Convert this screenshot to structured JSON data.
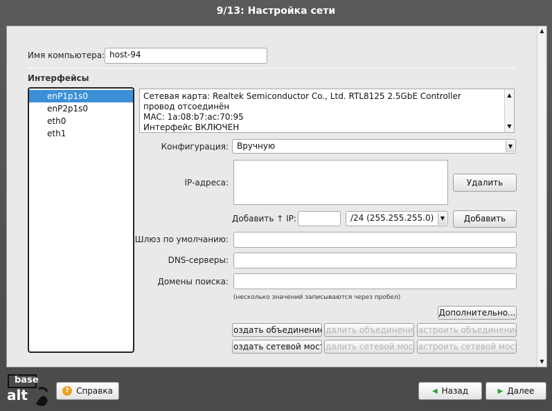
{
  "window": {
    "title": "9/13: Настройка сети"
  },
  "form": {
    "hostname_label": "Имя компьютера:",
    "hostname_value": "host-94",
    "interfaces_title": "Интерфейсы",
    "interfaces": [
      "enP1p1s0",
      "enP2p1s0",
      "eth0",
      "eth1"
    ],
    "selected_interface": "enP1p1s0",
    "info_lines": [
      "Сетевая карта: Realtek Semiconductor Co., Ltd. RTL8125 2.5GbE Controller",
      "провод отсоединён",
      "MAC: 1a:08:b7:ac:70:95",
      "Интерфейс ВКЛЮЧЕН"
    ],
    "config_label": "Конфигурация:",
    "config_value": "Вручную",
    "ip_label": "IP-адреса:",
    "delete_button": "Удалить",
    "add_ip_label": "Добавить ↑ IP:",
    "mask_value": "/24 (255.255.255.0)",
    "add_button": "Добавить",
    "gateway_label": "Шлюз по умолчанию:",
    "dns_label": "DNS-серверы:",
    "domains_label": "Домены поиска:",
    "hint": "(несколько значений записываются через пробел)",
    "advanced_button": "Дополнительно...",
    "bond_create": "оздать объединение.",
    "bond_delete": "далить объединение",
    "bond_config": "астроить объединение",
    "bridge_create": "оздать сетевой мост.",
    "bridge_delete": "далить сетевой мост",
    "bridge_config": "астроить сетевой мост"
  },
  "footer": {
    "logo_line1": "base",
    "logo_line2": "alt",
    "help_button": "Справка",
    "back_button": "Назад",
    "next_button": "Далее"
  }
}
